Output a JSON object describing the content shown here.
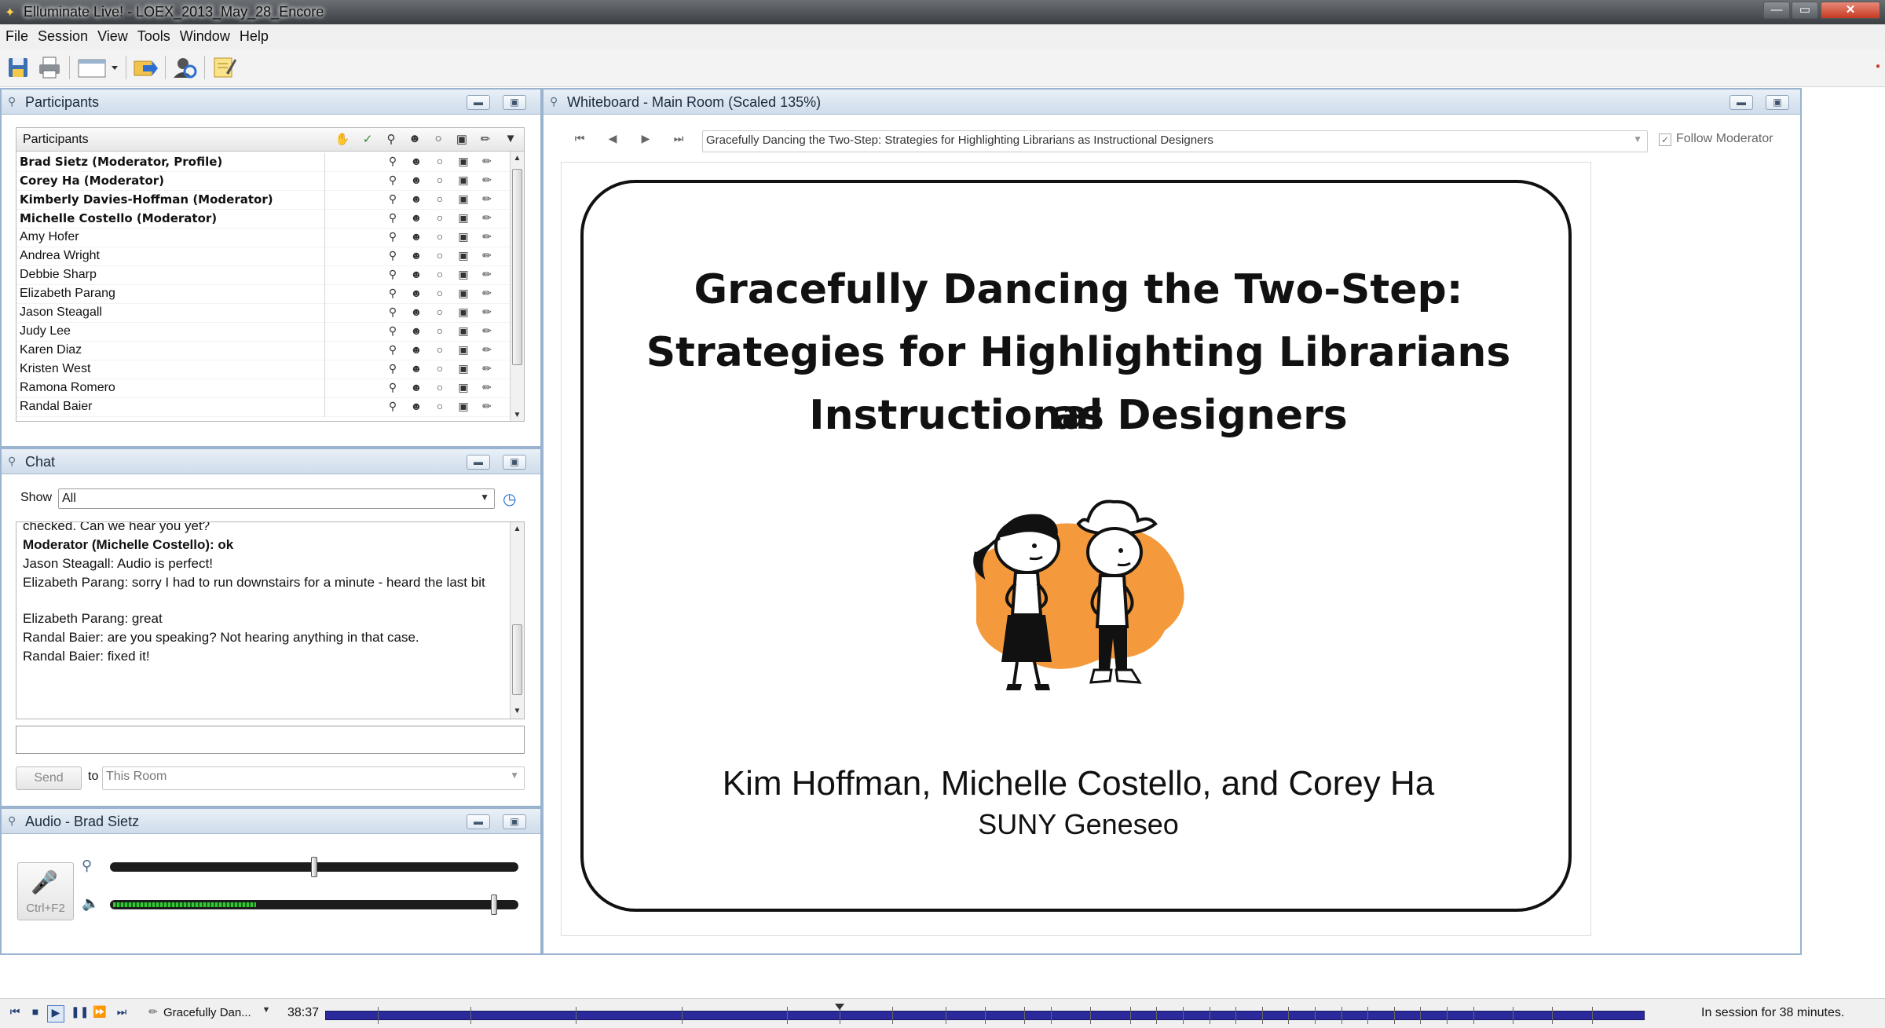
{
  "window": {
    "title": "Elluminate Live! - LOEX_2013_May_28_Encore",
    "controls": {
      "minimize": "—",
      "maximize": "▭",
      "close": "✕"
    }
  },
  "menu": [
    "File",
    "Session",
    "View",
    "Tools",
    "Window",
    "Help"
  ],
  "toolbar": {
    "icons": [
      "save-icon",
      "print-icon",
      "layout-icon",
      "load-icon",
      "profile-icon",
      "notes-icon"
    ]
  },
  "participants": {
    "panel_title": "Participants",
    "column_title": "Participants",
    "rows": [
      {
        "name": "Brad Sietz (Moderator, Profile)",
        "bold": true
      },
      {
        "name": "Corey Ha (Moderator)",
        "bold": true
      },
      {
        "name": "Kimberly Davies-Hoffman (Moderator)",
        "bold": true
      },
      {
        "name": "Michelle Costello (Moderator)",
        "bold": true
      },
      {
        "name": "Amy Hofer",
        "bold": false
      },
      {
        "name": "Andrea Wright",
        "bold": false
      },
      {
        "name": "Debbie Sharp",
        "bold": false
      },
      {
        "name": "Elizabeth Parang",
        "bold": false
      },
      {
        "name": "Jason Steagall",
        "bold": false
      },
      {
        "name": "Judy Lee",
        "bold": false
      },
      {
        "name": "Karen Diaz",
        "bold": false
      },
      {
        "name": "Kristen West",
        "bold": false
      },
      {
        "name": "Ramona Romero",
        "bold": false
      },
      {
        "name": "Randal Baier",
        "bold": false
      }
    ]
  },
  "chat": {
    "panel_title": "Chat",
    "show_label": "Show",
    "show_value": "All",
    "messages": [
      {
        "text": "checked.  Can we hear you yet?",
        "bold": false
      },
      {
        "sender": "Moderator (Michelle Costello):",
        "text": " ok",
        "bold": true
      },
      {
        "text": "Jason Steagall: Audio is perfect!",
        "bold": false
      },
      {
        "text": "Elizabeth Parang: sorry I had to run downstairs for a minute - heard the last bit",
        "bold": false
      },
      {
        "text": "Elizabeth Parang: great",
        "bold": false
      },
      {
        "text": "Randal Baier: are you speaking? Not hearing anything in that case.",
        "bold": false
      },
      {
        "text": "Randal Baier: fixed it!",
        "bold": false
      }
    ],
    "send_label": "Send",
    "to_label": "to",
    "to_value": "This Room"
  },
  "audio": {
    "panel_title": "Audio - Brad Sietz",
    "talk_shortcut": "Ctrl+F2",
    "mic_level": 0.5,
    "speaker_volume": 0.94,
    "speaker_activity": 0.35
  },
  "whiteboard": {
    "panel_title": "Whiteboard - Main Room (Scaled 135%)",
    "page_select": "Gracefully Dancing the Two-Step: Strategies for Highlighting Librarians as Instructional Designers",
    "follow_moderator_label": "Follow Moderator",
    "follow_moderator_checked": true,
    "slide": {
      "title_lines": [
        "Gracefully Dancing the Two-Step:",
        "Strategies for Highlighting Librarians as",
        "Instructional Designers"
      ],
      "authors": "Kim Hoffman, Michelle Costello, and Corey Ha",
      "affiliation": "SUNY Geneseo"
    }
  },
  "playback": {
    "title": "Gracefully Dan...",
    "time": "38:37",
    "status": "In session for 38 minutes.",
    "position": 0.39
  },
  "colors": {
    "panel_border": "#9ab4cf",
    "panel_header_top": "#e9f0f7",
    "panel_header_bottom": "#cfdceb",
    "timeline": "#2b2a9c",
    "illustration_orange": "#f49a3c"
  }
}
